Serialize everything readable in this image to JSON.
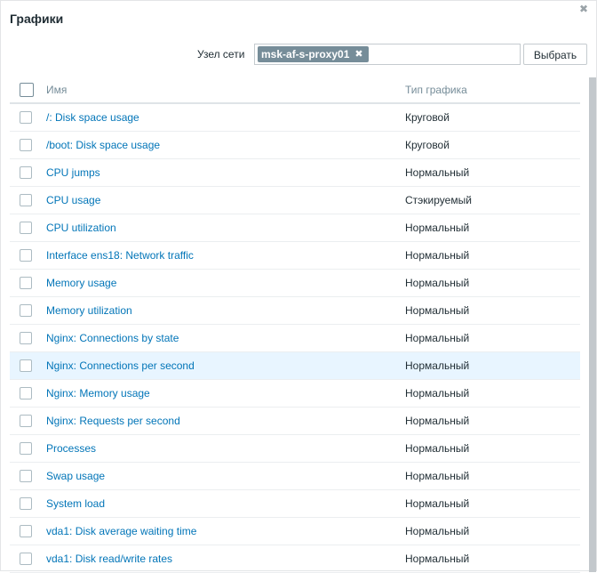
{
  "dialog": {
    "title": "Графики",
    "close_icon": "✖"
  },
  "host": {
    "label": "Узел сети",
    "selected": "msk-af-s-proxy01",
    "remove_icon": "✖",
    "select_button": "Выбрать"
  },
  "table": {
    "columns": {
      "name": "Имя",
      "type": "Тип графика"
    },
    "rows": [
      {
        "name": "/: Disk space usage",
        "type": "Круговой"
      },
      {
        "name": "/boot: Disk space usage",
        "type": "Круговой"
      },
      {
        "name": "CPU jumps",
        "type": "Нормальный"
      },
      {
        "name": "CPU usage",
        "type": "Стэкируемый"
      },
      {
        "name": "CPU utilization",
        "type": "Нормальный"
      },
      {
        "name": "Interface ens18: Network traffic",
        "type": "Нормальный"
      },
      {
        "name": "Memory usage",
        "type": "Нормальный"
      },
      {
        "name": "Memory utilization",
        "type": "Нормальный"
      },
      {
        "name": "Nginx: Connections by state",
        "type": "Нормальный"
      },
      {
        "name": "Nginx: Connections per second",
        "type": "Нормальный"
      },
      {
        "name": "Nginx: Memory usage",
        "type": "Нормальный"
      },
      {
        "name": "Nginx: Requests per second",
        "type": "Нормальный"
      },
      {
        "name": "Processes",
        "type": "Нормальный"
      },
      {
        "name": "Swap usage",
        "type": "Нормальный"
      },
      {
        "name": "System load",
        "type": "Нормальный"
      },
      {
        "name": "vda1: Disk average waiting time",
        "type": "Нормальный"
      },
      {
        "name": "vda1: Disk read/write rates",
        "type": "Нормальный"
      }
    ]
  }
}
